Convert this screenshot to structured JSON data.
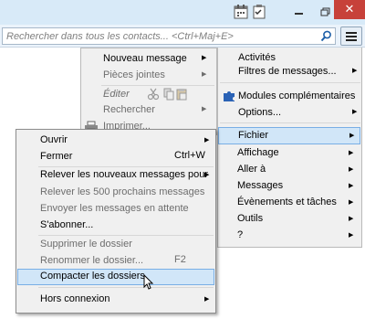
{
  "search": {
    "placeholder": "Rechercher dans tous les contacts... <Ctrl+Maj+E>"
  },
  "app_menu_left": {
    "items": [
      {
        "label": "Nouveau message",
        "disabled": false,
        "submenu": true
      },
      {
        "label": "Pièces jointes",
        "disabled": true,
        "submenu": true
      },
      {
        "label": "Éditer",
        "disabled": true
      },
      {
        "label": "Rechercher",
        "disabled": true,
        "submenu": true
      },
      {
        "label": "Imprimer...",
        "disabled": true,
        "submenu": true
      }
    ]
  },
  "app_menu_right": {
    "items": [
      {
        "label": "Activités"
      },
      {
        "label": "Filtres de messages...",
        "submenu": true
      },
      {
        "label": "Modules complémentaires"
      },
      {
        "label": "Options...",
        "submenu": true
      },
      {
        "label": "Fichier",
        "submenu": true,
        "highlighted": true
      },
      {
        "label": "Affichage",
        "submenu": true
      },
      {
        "label": "Aller à",
        "submenu": true
      },
      {
        "label": "Messages",
        "submenu": true
      },
      {
        "label": "Évènements et tâches",
        "submenu": true
      },
      {
        "label": "Outils",
        "submenu": true
      },
      {
        "label": "?",
        "submenu": true
      }
    ]
  },
  "file_menu": {
    "items": [
      {
        "label": "Ouvrir",
        "disabled": false,
        "submenu": true
      },
      {
        "label": "Fermer",
        "shortcut": "Ctrl+W",
        "disabled": false
      },
      {
        "label": "Relever les nouveaux messages pour",
        "disabled": false,
        "submenu": true
      },
      {
        "label": "Relever les 500 prochains messages",
        "disabled": true
      },
      {
        "label": "Envoyer les messages en attente",
        "disabled": true
      },
      {
        "label": "S'abonner...",
        "disabled": false
      },
      {
        "label": "Supprimer le dossier",
        "disabled": true
      },
      {
        "label": "Renommer le dossier...",
        "shortcut": "F2",
        "disabled": true
      },
      {
        "label": "Compacter les dossiers",
        "disabled": false,
        "highlighted": true
      },
      {
        "label": "Hors connexion",
        "disabled": false,
        "submenu": true
      }
    ]
  },
  "colors": {
    "titlebar": "#d8eaf8",
    "close_button": "#c7413a",
    "menu_bg": "#f0f0f0",
    "highlight": "#d1e6f8",
    "highlight_border": "#78aee5",
    "disabled_text": "#6d6d6d"
  },
  "icons": [
    "calendar-icon",
    "tasks-icon",
    "minimize-icon",
    "maximize-icon",
    "close-icon",
    "search-icon",
    "hamburger-menu-icon",
    "puzzle-icon",
    "printer-icon",
    "cut-icon",
    "copy-icon",
    "paste-icon",
    "cursor-icon"
  ]
}
